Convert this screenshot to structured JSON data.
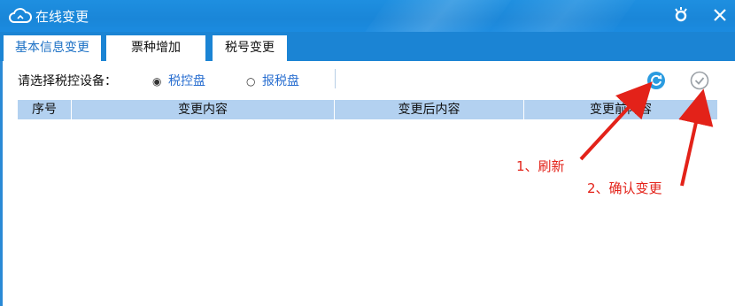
{
  "window": {
    "title": "在线变更"
  },
  "tabs": [
    {
      "label": "基本信息变更",
      "active": true
    },
    {
      "label": "票种增加",
      "active": false
    },
    {
      "label": "税号变更",
      "active": false
    }
  ],
  "device_selector": {
    "label": "请选择税控设备：",
    "options": [
      {
        "label": "税控盘",
        "selected": true
      },
      {
        "label": "报税盘",
        "selected": false
      }
    ]
  },
  "toolbar": {
    "refresh_icon": "refresh-icon",
    "confirm_icon": "check-circle-icon"
  },
  "table": {
    "columns": [
      "序号",
      "变更内容",
      "变更后内容",
      "变更前内容"
    ],
    "rows": []
  },
  "annotations": {
    "refresh": "1、刷新",
    "confirm": "2、确认变更"
  },
  "colors": {
    "titlebar": "#1b8be0",
    "header_row": "#b3d1f0",
    "annotation": "#e32219",
    "accent": "#2a9be0"
  }
}
